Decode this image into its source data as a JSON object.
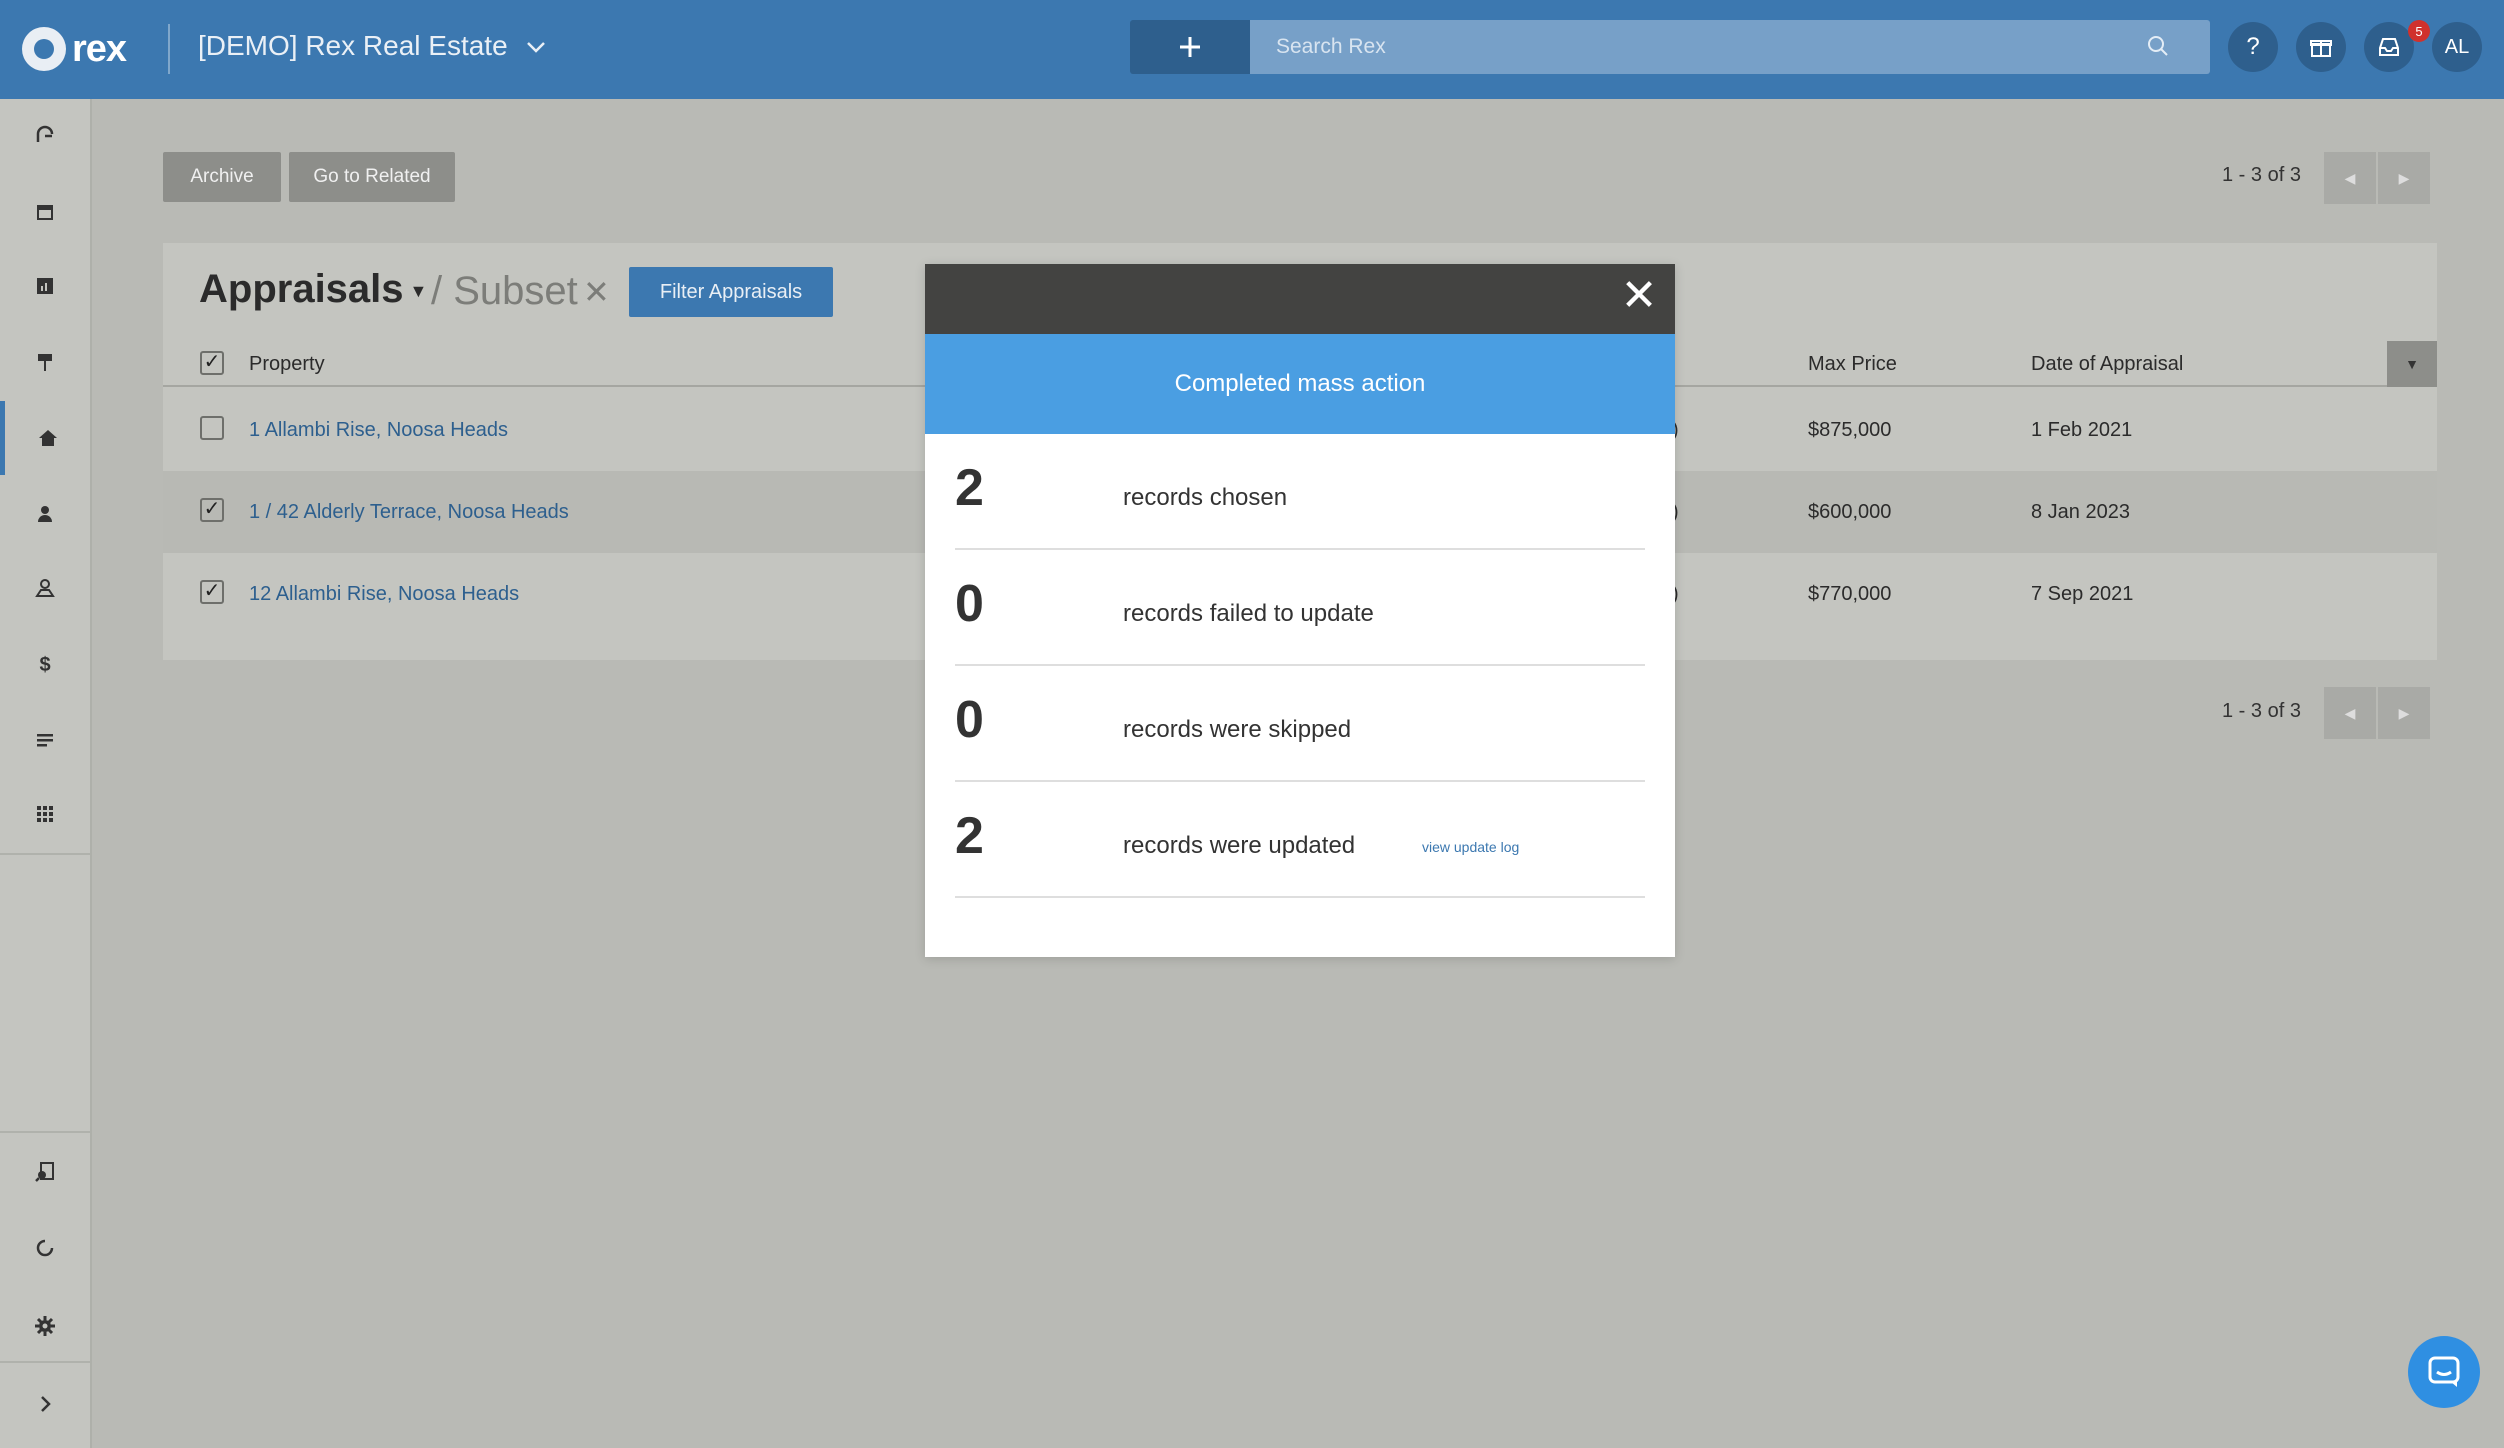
{
  "app": {
    "brand": "rex",
    "account_name": "[DEMO] Rex Real Estate",
    "user_initials": "AL",
    "notification_count": "5"
  },
  "search": {
    "placeholder": "Search Rex"
  },
  "toolbar": {
    "archive_label": "Archive",
    "go_related_label": "Go to Related",
    "pager_top": "1 - 3 of 3",
    "pager_bottom": "1 - 3 of 3"
  },
  "panel": {
    "title": "Appraisals",
    "subset": "/ Subset",
    "filter_label": "Filter Appraisals"
  },
  "table": {
    "headers": {
      "property": "Property",
      "max_price": "Max Price",
      "date": "Date of Appraisal"
    },
    "rows": [
      {
        "property": "1 Allambi Rise, Noosa Heads",
        "trunc": ")",
        "max_price": "$875,000",
        "date": "1 Feb 2021",
        "checked": "false"
      },
      {
        "property": "1 / 42 Alderly Terrace, Noosa Heads",
        "trunc": ")",
        "max_price": "$600,000",
        "date": "8 Jan 2023",
        "checked": "true"
      },
      {
        "property": "12 Allambi Rise, Noosa Heads",
        "trunc": ")",
        "max_price": "$770,000",
        "date": "7 Sep 2021",
        "checked": "true"
      }
    ]
  },
  "modal": {
    "close_glyph": "✕",
    "banner": "Completed mass action",
    "stats": [
      {
        "value": "2",
        "label": "records chosen"
      },
      {
        "value": "0",
        "label": "records failed to update"
      },
      {
        "value": "0",
        "label": "records were skipped"
      },
      {
        "value": "2",
        "label": "records were updated",
        "link": "view update log"
      }
    ]
  },
  "colors": {
    "topbar": "#3c78b0",
    "accent": "#4a9ee2",
    "link": "#2d5f8e",
    "badge": "#d0312d"
  }
}
